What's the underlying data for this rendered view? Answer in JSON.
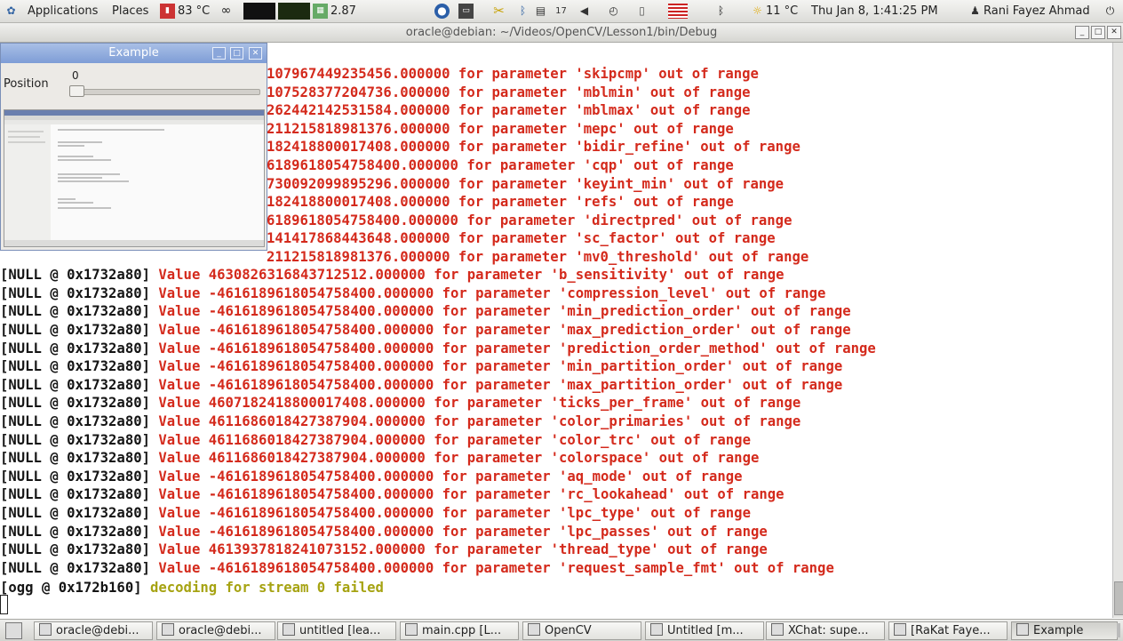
{
  "top_panel": {
    "menu_applications": "Applications",
    "menu_places": "Places",
    "cpu_temp": "83 °C",
    "load_value": "2.87",
    "weather": "11 °C",
    "datetime": "Thu Jan  8,  1:41:25 PM",
    "user_name": "Rani Fayez Ahmad"
  },
  "terminal": {
    "title": "oracle@debian: ~/Videos/OpenCV/Lesson1/bin/Debug",
    "lines": [
      {
        "prefix": "",
        "message": "107967449235456.000000 for parameter 'skipcmp' out of range"
      },
      {
        "prefix": "",
        "message": "107528377204736.000000 for parameter 'mblmin' out of range"
      },
      {
        "prefix": "",
        "message": "262442142531584.000000 for parameter 'mblmax' out of range"
      },
      {
        "prefix": "",
        "message": "211215818981376.000000 for parameter 'mepc' out of range"
      },
      {
        "prefix": "",
        "message": "182418800017408.000000 for parameter 'bidir_refine' out of range"
      },
      {
        "prefix": "",
        "message": "6189618054758400.000000 for parameter 'cqp' out of range"
      },
      {
        "prefix": "",
        "message": "730092099895296.000000 for parameter 'keyint_min' out of range"
      },
      {
        "prefix": "",
        "message": "182418800017408.000000 for parameter 'refs' out of range"
      },
      {
        "prefix": "",
        "message": "6189618054758400.000000 for parameter 'directpred' out of range"
      },
      {
        "prefix": "",
        "message": "141417868443648.000000 for parameter 'sc_factor' out of range"
      },
      {
        "prefix": "",
        "message": "211215818981376.000000 for parameter 'mv0_threshold' out of range"
      },
      {
        "prefix": "[NULL @ 0x1732a80] ",
        "message": "Value 4630826316843712512.000000 for parameter 'b_sensitivity' out of range"
      },
      {
        "prefix": "[NULL @ 0x1732a80] ",
        "message": "Value -4616189618054758400.000000 for parameter 'compression_level' out of range"
      },
      {
        "prefix": "[NULL @ 0x1732a80] ",
        "message": "Value -4616189618054758400.000000 for parameter 'min_prediction_order' out of range"
      },
      {
        "prefix": "[NULL @ 0x1732a80] ",
        "message": "Value -4616189618054758400.000000 for parameter 'max_prediction_order' out of range"
      },
      {
        "prefix": "[NULL @ 0x1732a80] ",
        "message": "Value -4616189618054758400.000000 for parameter 'prediction_order_method' out of range"
      },
      {
        "prefix": "[NULL @ 0x1732a80] ",
        "message": "Value -4616189618054758400.000000 for parameter 'min_partition_order' out of range"
      },
      {
        "prefix": "[NULL @ 0x1732a80] ",
        "message": "Value -4616189618054758400.000000 for parameter 'max_partition_order' out of range"
      },
      {
        "prefix": "[NULL @ 0x1732a80] ",
        "message": "Value 4607182418800017408.000000 for parameter 'ticks_per_frame' out of range"
      },
      {
        "prefix": "[NULL @ 0x1732a80] ",
        "message": "Value 4611686018427387904.000000 for parameter 'color_primaries' out of range"
      },
      {
        "prefix": "[NULL @ 0x1732a80] ",
        "message": "Value 4611686018427387904.000000 for parameter 'color_trc' out of range"
      },
      {
        "prefix": "[NULL @ 0x1732a80] ",
        "message": "Value 4611686018427387904.000000 for parameter 'colorspace' out of range"
      },
      {
        "prefix": "[NULL @ 0x1732a80] ",
        "message": "Value -4616189618054758400.000000 for parameter 'aq_mode' out of range"
      },
      {
        "prefix": "[NULL @ 0x1732a80] ",
        "message": "Value -4616189618054758400.000000 for parameter 'rc_lookahead' out of range"
      },
      {
        "prefix": "[NULL @ 0x1732a80] ",
        "message": "Value -4616189618054758400.000000 for parameter 'lpc_type' out of range"
      },
      {
        "prefix": "[NULL @ 0x1732a80] ",
        "message": "Value -4616189618054758400.000000 for parameter 'lpc_passes' out of range"
      },
      {
        "prefix": "[NULL @ 0x1732a80] ",
        "message": "Value 4613937818241073152.000000 for parameter 'thread_type' out of range"
      },
      {
        "prefix": "[NULL @ 0x1732a80] ",
        "message": "Value -4616189618054758400.000000 for parameter 'request_sample_fmt' out of range"
      }
    ],
    "last_line": {
      "prefix": "[ogg @ 0x172b160] ",
      "message": "decoding for stream 0 failed"
    }
  },
  "example_window": {
    "title": "Example",
    "trackbar_label": "Position",
    "trackbar_value": "0",
    "trackbar_level": 0
  },
  "taskbar": {
    "items": [
      {
        "label": "oracle@debi...",
        "icon": "terminal-icon"
      },
      {
        "label": "oracle@debi...",
        "icon": "terminal-icon"
      },
      {
        "label": "untitled [lea...",
        "icon": "editor-icon"
      },
      {
        "label": "main.cpp [L...",
        "icon": "editor-icon"
      },
      {
        "label": "OpenCV",
        "icon": "folder-icon"
      },
      {
        "label": "Untitled [m...",
        "icon": "paint-icon"
      },
      {
        "label": "XChat: supe...",
        "icon": "xchat-icon"
      },
      {
        "label": "[RaKat Faye...",
        "icon": "browser-icon"
      },
      {
        "label": "Example",
        "icon": "window-icon"
      }
    ]
  },
  "colors": {
    "terminal_red": "#d42a1c",
    "terminal_yellow": "#a6a312",
    "example_title_blue": "#7e9dd6"
  }
}
